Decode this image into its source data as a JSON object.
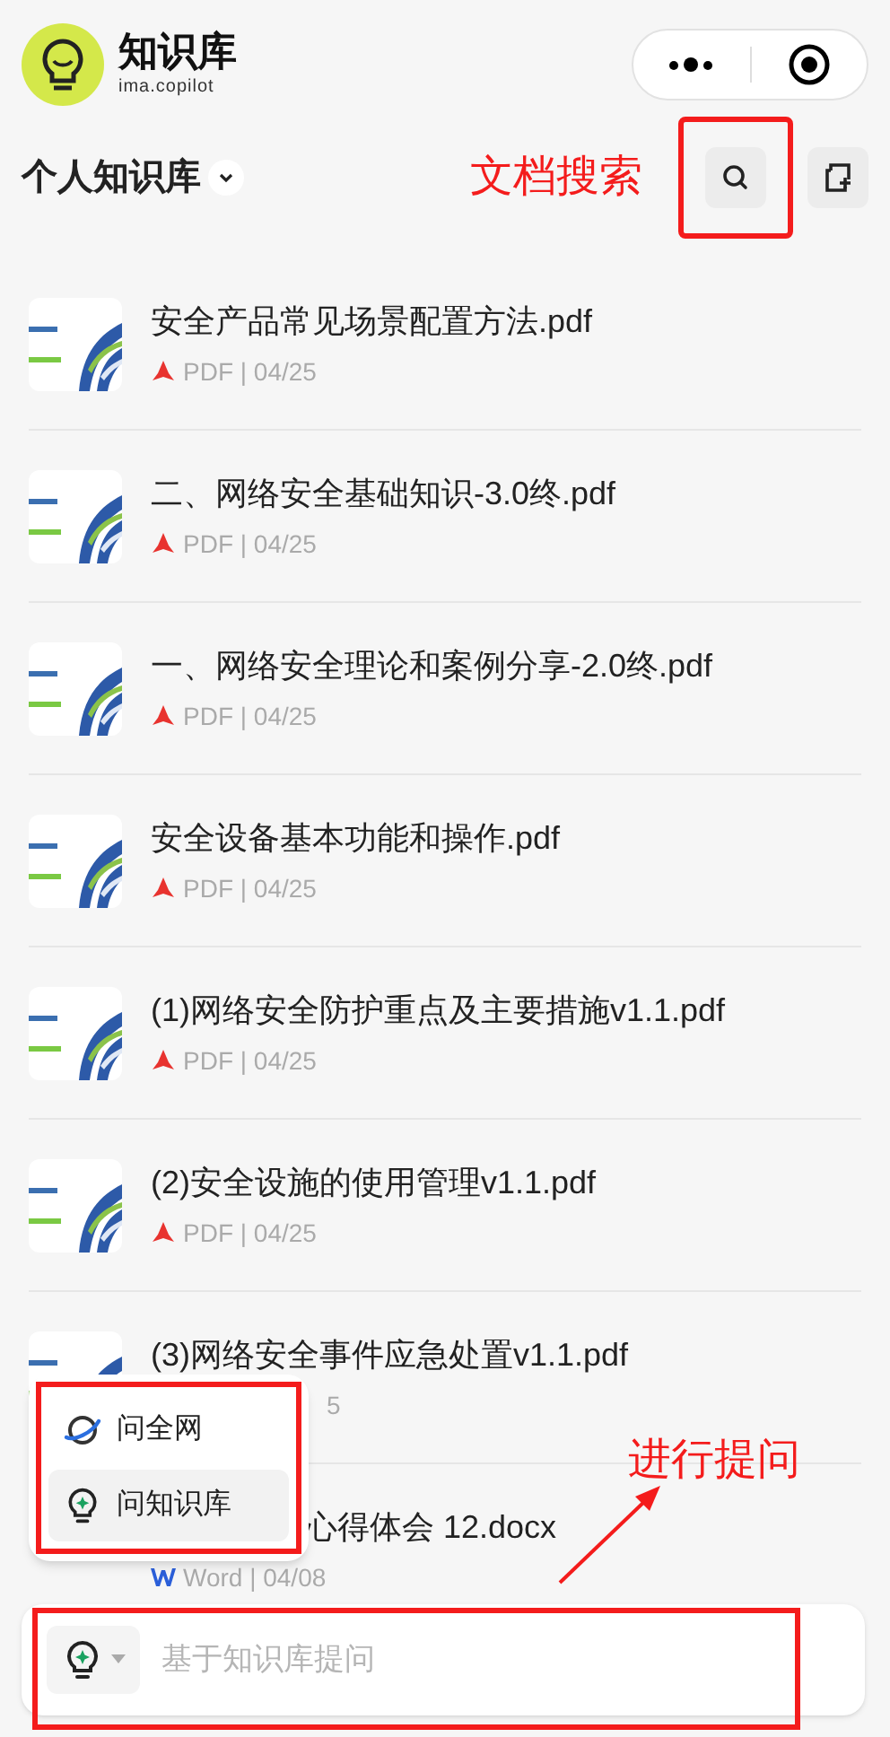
{
  "app": {
    "name": "知识库",
    "subtitle": "ima.copilot"
  },
  "library": {
    "title": "个人知识库"
  },
  "annotations": [
    {
      "text": "文档搜索"
    },
    {
      "text": "进行提问"
    }
  ],
  "documents": [
    {
      "title": "安全产品常见场景配置方法.pdf",
      "meta": "PDF | 04/25",
      "kind": "pdf"
    },
    {
      "title": "二、网络安全基础知识-3.0终.pdf",
      "meta": "PDF | 04/25",
      "kind": "pdf"
    },
    {
      "title": "一、网络安全理论和案例分享-2.0终.pdf",
      "meta": "PDF | 04/25",
      "kind": "pdf"
    },
    {
      "title": "安全设备基本功能和操作.pdf",
      "meta": "PDF | 04/25",
      "kind": "pdf"
    },
    {
      "title": "(1)网络安全防护重点及主要措施v1.1.pdf",
      "meta": "PDF | 04/25",
      "kind": "pdf"
    },
    {
      "title": "(2)安全设施的使用管理v1.1.pdf",
      "meta": "PDF | 04/25",
      "kind": "pdf"
    },
    {
      "title": "(3)网络安全事件应急处置v1.1.pdf",
      "meta": "5",
      "meta_covered": true
    },
    {
      "title": "心得体会 12.docx",
      "meta": "Word | 04/08",
      "kind": "word",
      "title_covered": true
    }
  ],
  "ask_menu": [
    {
      "label": "问全网",
      "selected": false,
      "kind": "web"
    },
    {
      "label": "问知识库",
      "selected": true,
      "kind": "kb"
    }
  ],
  "input": {
    "placeholder": "基于知识库提问"
  }
}
